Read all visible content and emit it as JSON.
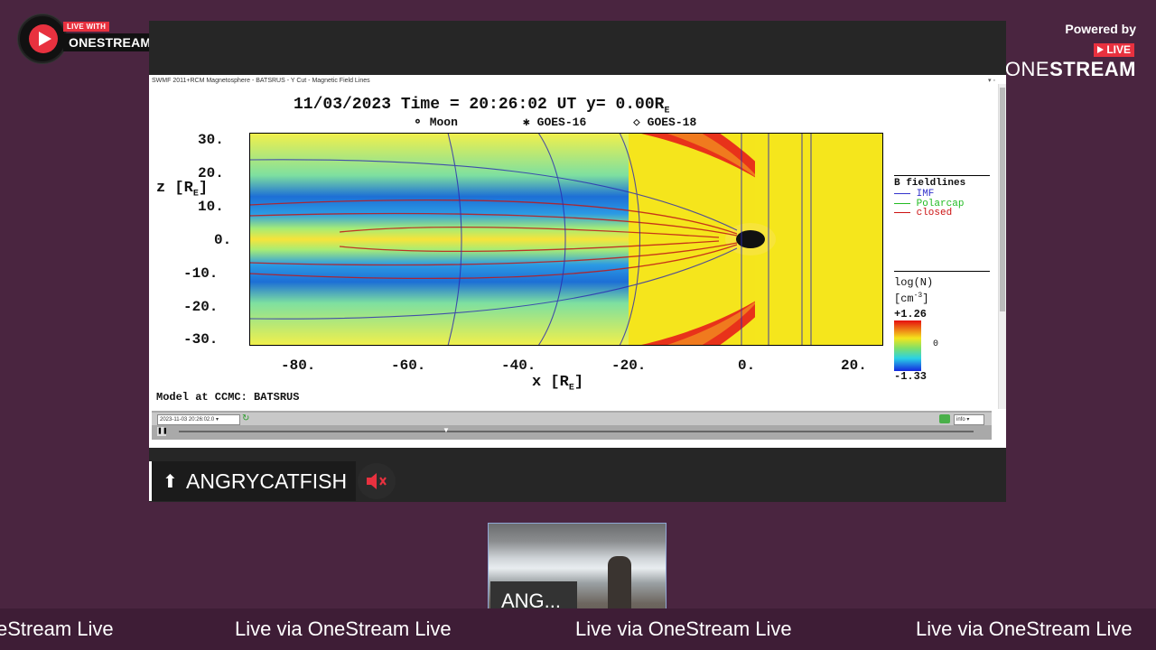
{
  "brand": {
    "live_with": "LIVE WITH",
    "onestream": "ONESTREAM",
    "powered_by": "Powered by",
    "pb_live": "LIVE",
    "pb_onestream_one": "ONE",
    "pb_onestream_stream": "STREAM"
  },
  "window": {
    "title": "SWMF 2011+RCM Magnetosphere - BATSRUS - Y Cut - Magnetic Field Lines",
    "datetime_select": "2023-11-03 20:26:02.0",
    "info_select": "info"
  },
  "plot": {
    "header": "11/03/2023 Time = 20:26:02 UT y= 0.00R",
    "header_sub": "E",
    "markers": {
      "moon": "Moon",
      "goes16": "GOES-16",
      "goes18": "GOES-18"
    },
    "y_axis_label": "z [R",
    "x_axis_label": "x [R",
    "axis_sub": "E",
    "y_ticks": [
      "30.",
      "20.",
      "10.",
      "0.",
      "-10.",
      "-20.",
      "-30."
    ],
    "x_ticks": [
      "-80.",
      "-60.",
      "-40.",
      "-20.",
      "0.",
      "20."
    ],
    "legend_title": "B fieldlines",
    "legend_items": [
      {
        "label": "IMF",
        "color": "#3333cc"
      },
      {
        "label": "Polarcap",
        "color": "#22bb22"
      },
      {
        "label": "closed",
        "color": "#cc1111"
      }
    ],
    "colorbar_title": "log(N)",
    "colorbar_unit": "[cm",
    "colorbar_unit_sup": "-3",
    "colorbar_max": "+1.26",
    "colorbar_mid": "0",
    "colorbar_min": "-1.33",
    "credit": "Model at CCMC: BATSRUS"
  },
  "speaker": {
    "name": "ANGRYCATFISH",
    "thumb_label": "ANG..."
  },
  "ticker": {
    "items": [
      "eStream Live",
      "Live via OneStream Live",
      "Live via OneStream Live",
      "Live via OneStream Live"
    ]
  },
  "colors": {
    "background": "#4a2540",
    "accent": "#e8313f",
    "stage": "#262626"
  }
}
